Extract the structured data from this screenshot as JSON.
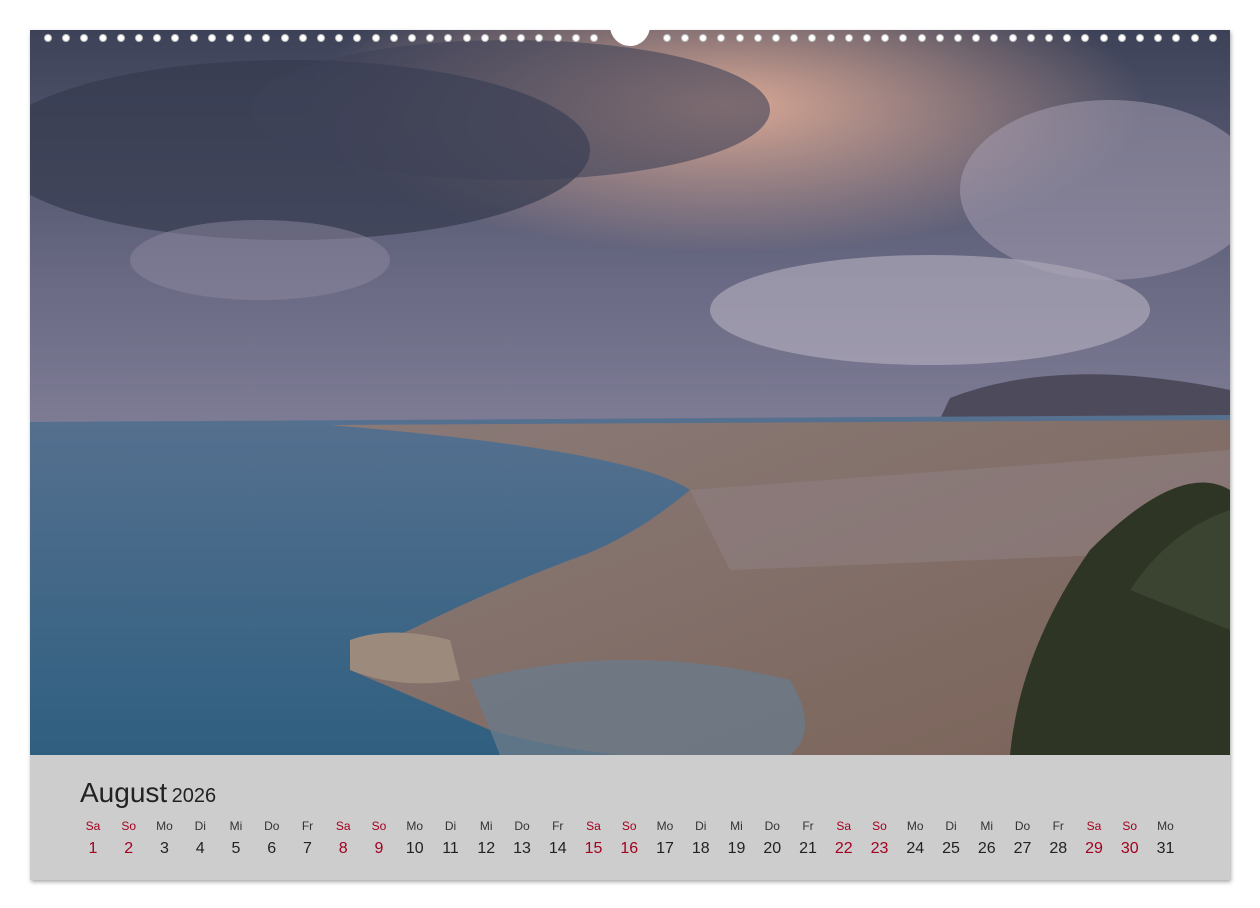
{
  "calendar": {
    "month": "August",
    "year": "2026",
    "weekend_color": "#a3001f",
    "days": [
      {
        "abbr": "Sa",
        "num": "1",
        "weekend": true
      },
      {
        "abbr": "So",
        "num": "2",
        "weekend": true
      },
      {
        "abbr": "Mo",
        "num": "3",
        "weekend": false
      },
      {
        "abbr": "Di",
        "num": "4",
        "weekend": false
      },
      {
        "abbr": "Mi",
        "num": "5",
        "weekend": false
      },
      {
        "abbr": "Do",
        "num": "6",
        "weekend": false
      },
      {
        "abbr": "Fr",
        "num": "7",
        "weekend": false
      },
      {
        "abbr": "Sa",
        "num": "8",
        "weekend": true
      },
      {
        "abbr": "So",
        "num": "9",
        "weekend": true
      },
      {
        "abbr": "Mo",
        "num": "10",
        "weekend": false
      },
      {
        "abbr": "Di",
        "num": "11",
        "weekend": false
      },
      {
        "abbr": "Mi",
        "num": "12",
        "weekend": false
      },
      {
        "abbr": "Do",
        "num": "13",
        "weekend": false
      },
      {
        "abbr": "Fr",
        "num": "14",
        "weekend": false
      },
      {
        "abbr": "Sa",
        "num": "15",
        "weekend": true
      },
      {
        "abbr": "So",
        "num": "16",
        "weekend": true
      },
      {
        "abbr": "Mo",
        "num": "17",
        "weekend": false
      },
      {
        "abbr": "Di",
        "num": "18",
        "weekend": false
      },
      {
        "abbr": "Mi",
        "num": "19",
        "weekend": false
      },
      {
        "abbr": "Do",
        "num": "20",
        "weekend": false
      },
      {
        "abbr": "Fr",
        "num": "21",
        "weekend": false
      },
      {
        "abbr": "Sa",
        "num": "22",
        "weekend": true
      },
      {
        "abbr": "So",
        "num": "23",
        "weekend": true
      },
      {
        "abbr": "Mo",
        "num": "24",
        "weekend": false
      },
      {
        "abbr": "Di",
        "num": "25",
        "weekend": false
      },
      {
        "abbr": "Mi",
        "num": "26",
        "weekend": false
      },
      {
        "abbr": "Do",
        "num": "27",
        "weekend": false
      },
      {
        "abbr": "Fr",
        "num": "28",
        "weekend": false
      },
      {
        "abbr": "Sa",
        "num": "29",
        "weekend": true
      },
      {
        "abbr": "So",
        "num": "30",
        "weekend": true
      },
      {
        "abbr": "Mo",
        "num": "31",
        "weekend": false
      }
    ]
  }
}
